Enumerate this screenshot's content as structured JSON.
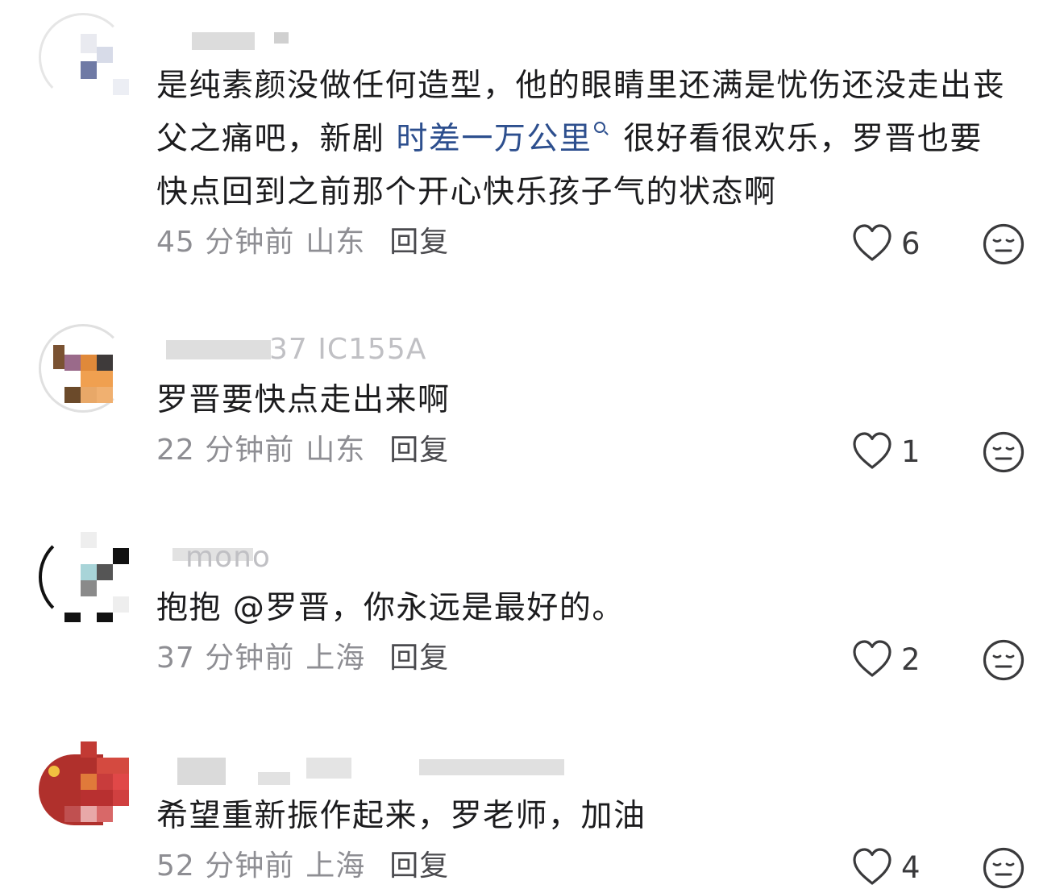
{
  "comments": [
    {
      "username": "",
      "text_pre": "是纯素颜没做任何造型，他的眼睛里还满是忧伤还没走出丧父之痛吧，新剧 ",
      "link": "时差一万公里",
      "text_post": "很好看很欢乐，罗晋也要快点回到之前那个开心快乐孩子气的状态啊",
      "time": "45 分钟前",
      "location": "山东",
      "reply": "回复",
      "likes": "6"
    },
    {
      "username": "37 IC155A",
      "text": "罗晋要快点走出来啊",
      "time": "22 分钟前",
      "location": "山东",
      "reply": "回复",
      "likes": "1"
    },
    {
      "username": "mono",
      "text": "抱抱 @罗晋，你永远是最好的。",
      "time": "37 分钟前",
      "location": "上海",
      "reply": "回复",
      "likes": "2"
    },
    {
      "username": "",
      "text": "希望重新振作起来，罗老师，加油",
      "time": "52 分钟前",
      "location": "上海",
      "reply": "回复",
      "likes": "4"
    }
  ],
  "icons": {
    "like": "heart-outline-icon",
    "emoji": "neutral-face-icon"
  },
  "colors": {
    "text": "#1c1c1e",
    "meta": "#8e8e93",
    "link": "#2d4f8e",
    "icon": "#3a3a3c"
  }
}
